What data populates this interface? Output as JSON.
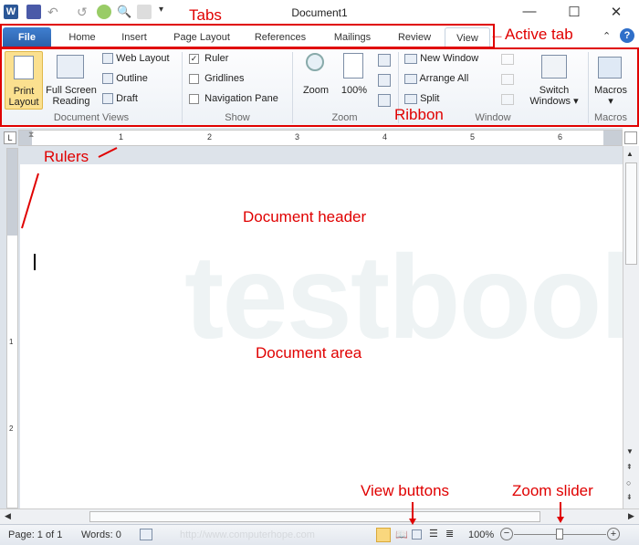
{
  "window": {
    "title": "Document1",
    "minimize": "—",
    "maximize": "☐",
    "close": "✕"
  },
  "quick_access": [
    "word-logo-icon",
    "save-icon",
    "undo-icon",
    "redo-icon",
    "circle-icon",
    "print-preview-icon",
    "comment-icon",
    "customize-dropdown-icon"
  ],
  "tabs": [
    {
      "label": "File"
    },
    {
      "label": "Home"
    },
    {
      "label": "Insert"
    },
    {
      "label": "Page Layout"
    },
    {
      "label": "References"
    },
    {
      "label": "Mailings"
    },
    {
      "label": "Review"
    },
    {
      "label": "View",
      "active": true
    }
  ],
  "ribbon": {
    "document_views": {
      "label": "Document Views",
      "print_layout": "Print Layout",
      "full_screen": "Full Screen Reading",
      "web_layout": "Web Layout",
      "outline": "Outline",
      "draft": "Draft"
    },
    "show": {
      "label": "Show",
      "ruler": {
        "label": "Ruler",
        "checked": true
      },
      "gridlines": {
        "label": "Gridlines",
        "checked": false
      },
      "navigation_pane": {
        "label": "Navigation Pane",
        "checked": false
      }
    },
    "zoom": {
      "label": "Zoom",
      "zoom": "Zoom",
      "hundred": "100%"
    },
    "window": {
      "label": "Window",
      "new_window": "New Window",
      "arrange_all": "Arrange All",
      "split": "Split",
      "switch_windows": "Switch Windows"
    },
    "macros": {
      "label": "Macros",
      "macros": "Macros"
    }
  },
  "ruler": {
    "h_ticks": [
      "1",
      "2",
      "3",
      "4",
      "5",
      "6"
    ],
    "v_ticks": [
      "1",
      "2"
    ]
  },
  "watermark": "testbook",
  "status": {
    "page": "Page: 1 of 1",
    "words": "Words: 0",
    "url": "http://www.computerhope.com",
    "zoom": "100%",
    "zoom_slider_percent": 50
  },
  "annotations": {
    "tabs": "Tabs",
    "active_tab": "Active tab",
    "ribbon": "Ribbon",
    "rulers": "Rulers",
    "header": "Document header",
    "area": "Document area",
    "view_buttons": "View buttons",
    "zoom_slider": "Zoom slider"
  },
  "colors": {
    "file_tab": "#2a5fa8",
    "annotation": "#e00000",
    "active_view": "#f9d77e"
  }
}
